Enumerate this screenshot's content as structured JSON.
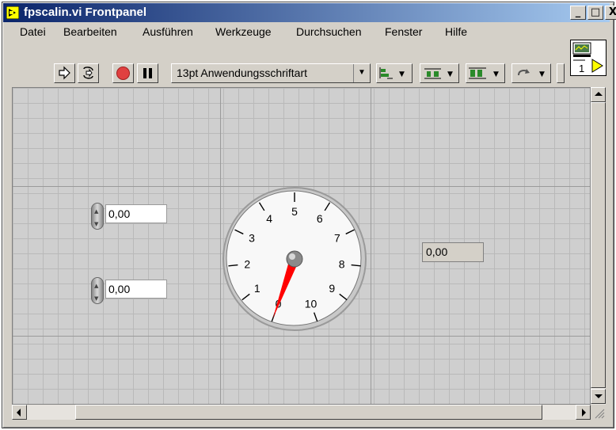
{
  "window": {
    "title": "fpscalin.vi Frontpanel"
  },
  "titlebar_buttons": {
    "minimize": "_",
    "maximize": "□",
    "close": "X"
  },
  "menu": {
    "items": [
      {
        "label": "Datei",
        "accel": "D"
      },
      {
        "label": "Bearbeiten",
        "accel": "B"
      },
      {
        "label": "Ausführen",
        "accel": "A"
      },
      {
        "label": "Werkzeuge",
        "accel": "W"
      },
      {
        "label": "Durchsuchen",
        "accel": "D"
      },
      {
        "label": "Fenster",
        "accel": "F"
      },
      {
        "label": "Hilfe",
        "accel": "H"
      }
    ]
  },
  "toolbar": {
    "font_label": "13pt Anwendungsschriftart",
    "connector_number": "1"
  },
  "controls": {
    "numeric1": "0,00",
    "numeric2": "0,00",
    "indicator": "0,00"
  },
  "gauge": {
    "scale_labels": [
      "0",
      "1",
      "2",
      "3",
      "4",
      "5",
      "6",
      "7",
      "8",
      "9",
      "10"
    ],
    "value": 0,
    "min": 0,
    "max": 10,
    "needle_color": "#ff0000"
  }
}
